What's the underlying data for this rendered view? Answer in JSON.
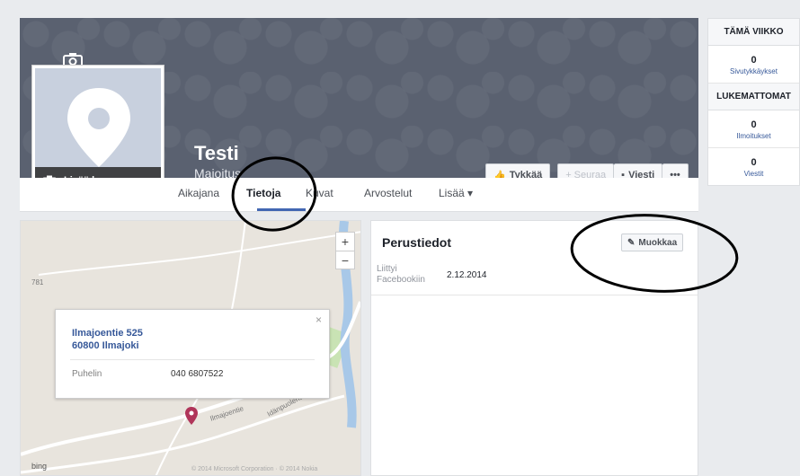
{
  "page": {
    "name": "Testi",
    "category": "Majoitus",
    "add_photo_label": "Lisää kuva"
  },
  "actions": {
    "like": "Tykkää",
    "follow": "+ Seuraa",
    "message": "Viesti",
    "more": "•••"
  },
  "tabs": [
    "Aikajana",
    "Tietoja",
    "Kuvat",
    "Arvostelut",
    "Lisää ▾"
  ],
  "active_tab": "Tietoja",
  "map": {
    "zoom_in": "+",
    "zoom_out": "−",
    "road_number": "781",
    "popup": {
      "close": "×",
      "address_line1": "Ilmajoentie 525",
      "address_line2": "60800 Ilmajoki",
      "phone_label": "Puhelin",
      "phone_value": "040 6807522"
    },
    "road_label_1": "Ilmajoentie",
    "road_label_2": "Idänpuolentie",
    "bing": "bing",
    "copyright": "© 2014 Microsoft Corporation · © 2014 Nokia"
  },
  "info": {
    "title": "Perustiedot",
    "edit": "Muokkaa",
    "joined_label": "Liittyi Facebookiin",
    "joined_value": "2.12.2014"
  },
  "sidebar": {
    "this_week": "TÄMÄ VIIKKO",
    "visits_count": "0",
    "visits_label": "Sivutykkäykset",
    "unread": "LUKEMATTOMAT",
    "notif_count": "0",
    "notif_label": "Ilmoitukset",
    "msg_count": "0",
    "msg_label": "Viestit"
  },
  "colors": {
    "cover": "#5a6170",
    "link": "#365899",
    "tab_underline": "#4267b2",
    "map_pin": "#b0355a"
  }
}
